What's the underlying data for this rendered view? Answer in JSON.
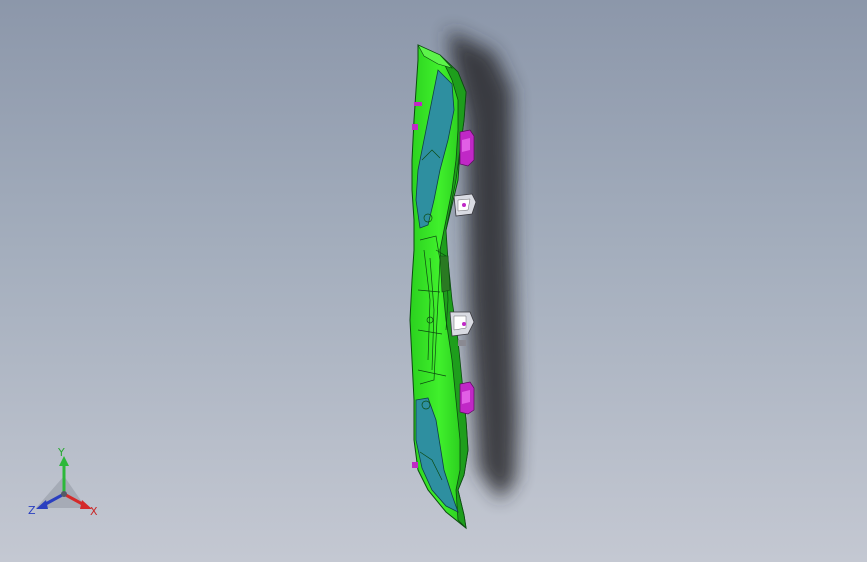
{
  "viewport": {
    "background_top": "#8c97aa",
    "background_bottom": "#c4c8d2"
  },
  "model": {
    "colors": {
      "panel": "#32e626",
      "panel_dark": "#1e9e1c",
      "edge": "#0c4a10",
      "reinforcement": "#2e8fa0",
      "bracket": "#c028c6",
      "mount": "#d9dbe2",
      "shadow": "#2a2a2e"
    }
  },
  "triad": {
    "x_label": "X",
    "y_label": "Y",
    "z_label": "Z",
    "x_color": "#d42a2a",
    "y_color": "#2cb83a",
    "z_color": "#2a3fc0"
  }
}
